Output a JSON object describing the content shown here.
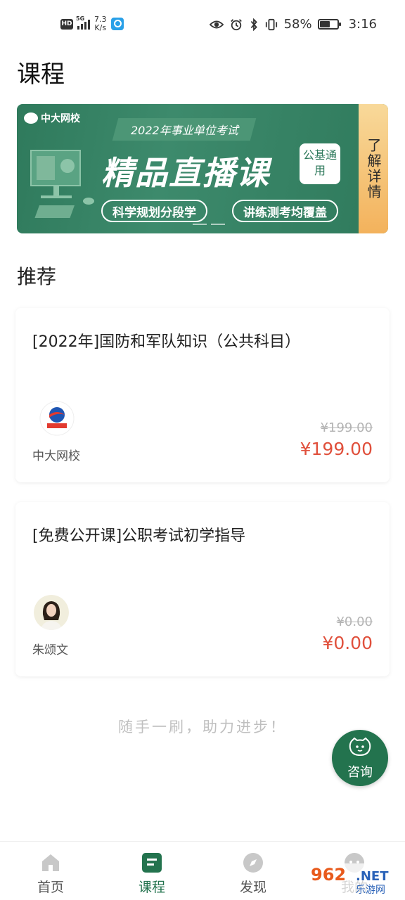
{
  "status_bar": {
    "hd": "HD",
    "network": "5G",
    "speed_value": "7.3",
    "speed_unit": "K/s",
    "battery": "58%",
    "time": "3:16"
  },
  "header": {
    "title": "课程"
  },
  "banner": {
    "logo": "中大网校",
    "year_tag": "2022年事业单位考试",
    "headline": "精品直播课",
    "pub_tag": "公基通用",
    "pill1": "科学规划分段学",
    "pill2": "讲练测考均覆盖",
    "side_tab": "了解详情",
    "colors": {
      "green": "#2f7a5c",
      "gold": "#f3b25c"
    }
  },
  "recommend": {
    "title": "推荐",
    "courses": [
      {
        "title": "[2022年]国防和军队知识（公共科目）",
        "author": "中大网校",
        "old_price": "¥199.00",
        "price": "¥199.00",
        "avatar": "logo-avatar"
      },
      {
        "title": "[免费公开课]公职考试初学指导",
        "author": "朱颂文",
        "old_price": "¥0.00",
        "price": "¥0.00",
        "avatar": "portrait-avatar"
      }
    ]
  },
  "footer_note": "随手一刷，助力进步！",
  "consult": {
    "label": "咨询"
  },
  "tabbar": {
    "items": [
      {
        "label": "首页",
        "icon": "home-icon"
      },
      {
        "label": "课程",
        "icon": "course-icon",
        "active": true
      },
      {
        "label": "发现",
        "icon": "compass-icon"
      },
      {
        "label": "我的",
        "icon": "profile-icon"
      }
    ]
  },
  "watermark": "962.NET 乐游网"
}
